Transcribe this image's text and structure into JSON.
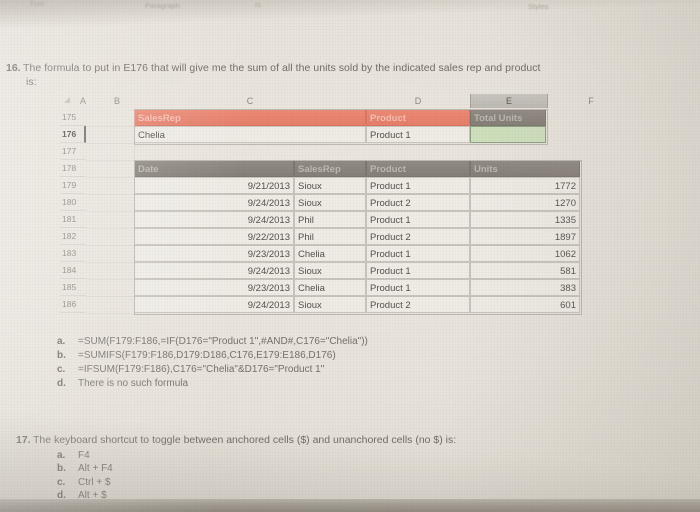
{
  "ribbon": {
    "left_label": "Font",
    "paragraph": "Paragraph",
    "fs_marker": "rs",
    "styles": "Styles"
  },
  "questions": [
    {
      "number": "16.",
      "text": "The formula to put in E176 that will give me the sum of all the units sold by the indicated sales rep and product",
      "text_cont": "is:",
      "options": [
        {
          "letter": "a.",
          "text": "=SUM(F179:F186,=IF(D176=\"Product 1\",#AND#,C176=\"Chelia\"))"
        },
        {
          "letter": "b.",
          "text": "=SUMIFS(F179:F186,D179:D186,C176,E179:E186,D176)"
        },
        {
          "letter": "c.",
          "text": "=IFSUM(F179:F186),C176=\"Chelia\"&D176=\"Product 1\""
        },
        {
          "letter": "d.",
          "text": "There is no such formula"
        }
      ]
    },
    {
      "number": "17.",
      "text": "The keyboard shortcut to toggle between anchored cells ($) and unanchored cells (no $) is:",
      "options": [
        {
          "letter": "a.",
          "text": "F4"
        },
        {
          "letter": "b.",
          "text": "Alt + F4"
        },
        {
          "letter": "c.",
          "text": "Ctrl + $"
        },
        {
          "letter": "d.",
          "text": "Alt + $"
        }
      ]
    }
  ],
  "spreadsheet": {
    "column_letters": [
      "A",
      "B",
      "C",
      "D",
      "E",
      "F"
    ],
    "selected_column": "E",
    "row_numbers": [
      "175",
      "176",
      "177",
      "178",
      "179",
      "180",
      "181",
      "182",
      "183",
      "184",
      "185",
      "186"
    ],
    "active_row": "176",
    "criteria_table": {
      "header_fill": "#e5806c",
      "headers": {
        "salesrep": "SalesRep",
        "product": "Product",
        "total_units": "Total Units"
      },
      "values": {
        "salesrep": "Chelia",
        "product": "Product 1",
        "total_units": ""
      },
      "result_cell_fill": "#cfe0bd"
    },
    "data_table": {
      "header_fill": "#8a847c",
      "headers": [
        "Date",
        "SalesRep",
        "Product",
        "Units"
      ],
      "rows": [
        {
          "date": "9/21/2013",
          "salesrep": "Sioux",
          "product": "Product 1",
          "units": "1772"
        },
        {
          "date": "9/24/2013",
          "salesrep": "Sioux",
          "product": "Product 2",
          "units": "1270"
        },
        {
          "date": "9/24/2013",
          "salesrep": "Phil",
          "product": "Product 1",
          "units": "1335"
        },
        {
          "date": "9/22/2013",
          "salesrep": "Phil",
          "product": "Product 2",
          "units": "1897"
        },
        {
          "date": "9/23/2013",
          "salesrep": "Chelia",
          "product": "Product 1",
          "units": "1062"
        },
        {
          "date": "9/24/2013",
          "salesrep": "Sioux",
          "product": "Product 1",
          "units": "581"
        },
        {
          "date": "9/23/2013",
          "salesrep": "Chelia",
          "product": "Product 1",
          "units": "383"
        },
        {
          "date": "9/24/2013",
          "salesrep": "Sioux",
          "product": "Product 2",
          "units": "601"
        }
      ]
    }
  }
}
